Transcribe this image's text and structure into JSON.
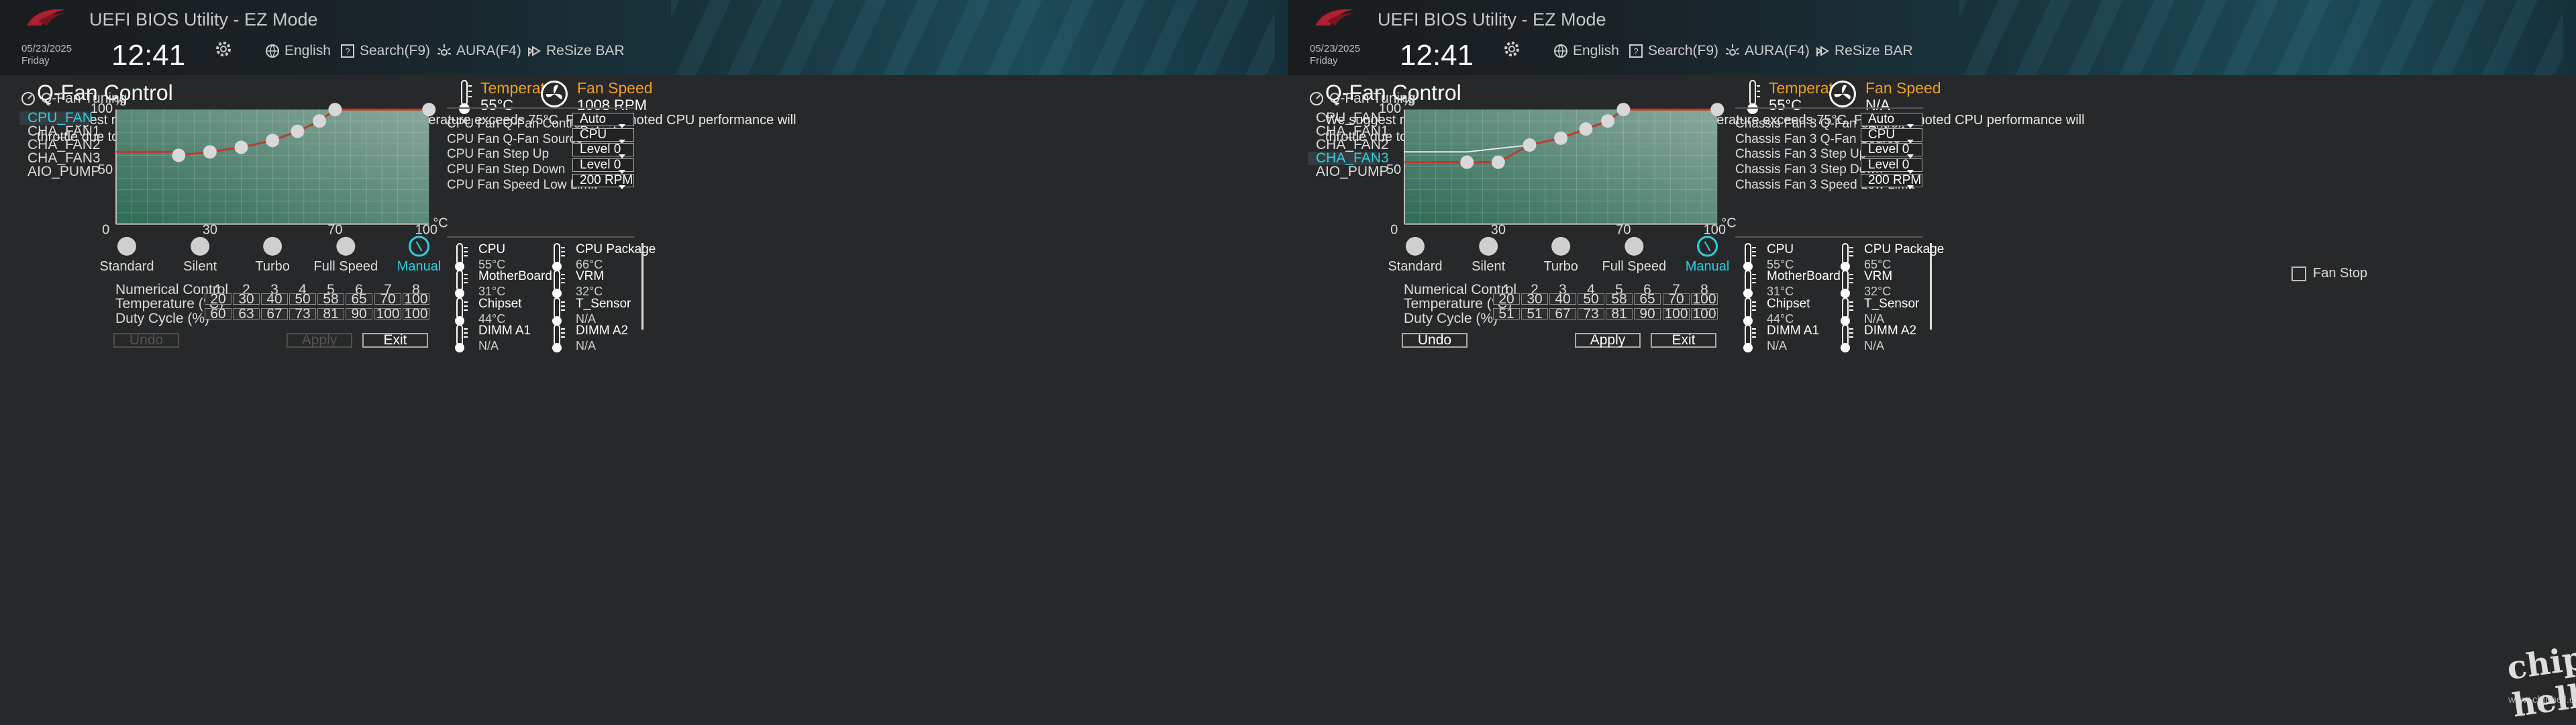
{
  "screens": [
    {
      "header": {
        "app_title": "UEFI BIOS Utility - EZ Mode",
        "date": "05/23/2025",
        "day": "Friday",
        "time": "12:41",
        "language": "English",
        "search": "Search(F9)",
        "aura": "AURA(F4)",
        "resize_bar": "ReSize BAR"
      },
      "page_title": "Q-Fan Control",
      "warning_line1": "We suggest raising your fan/pump duty to 100% if your CPU temperature exceeds 75°C. Please be noted CPU performance will",
      "warning_line2": "throttle due to overheating with inefficient fan/pump duty.",
      "tuning_label": "Q-Fan Tuning",
      "fans": [
        "CPU_FAN",
        "CHA_FAN1",
        "CHA_FAN2",
        "CHA_FAN3",
        "AIO_PUMP"
      ],
      "selected_fan": 0,
      "chart_data": {
        "type": "line",
        "xlabel": "°C",
        "ylabel": "%",
        "xlim": [
          0,
          100
        ],
        "ylim": [
          0,
          100
        ],
        "x_ticks": [
          "0",
          "30",
          "70",
          "100"
        ],
        "y_ticks": [
          "100",
          "50",
          "0"
        ],
        "grid": true,
        "series": [
          {
            "x": [
              0,
              20,
              20,
              30,
              40,
              50,
              58,
              65,
              70,
              100,
              100
            ],
            "y": [
              63,
              63,
              60,
              63,
              67,
              73,
              81,
              90,
              100,
              100,
              100
            ],
            "points": [
              [
                20,
                60
              ],
              [
                30,
                63
              ],
              [
                40,
                67
              ],
              [
                50,
                73
              ],
              [
                58,
                81
              ],
              [
                65,
                90
              ],
              [
                70,
                100
              ],
              [
                100,
                100
              ]
            ]
          }
        ],
        "reference_line": null
      },
      "presets": [
        "Standard",
        "Silent",
        "Turbo",
        "Full Speed",
        "Manual"
      ],
      "active_preset": 4,
      "fan_stop": null,
      "numerical_label": "Numerical Control",
      "temperature_label": "Temperature (°C)",
      "duty_label": "Duty Cycle (%)",
      "indices": [
        "1",
        "2",
        "3",
        "4",
        "5",
        "6",
        "7",
        "8"
      ],
      "temperatures": [
        "20",
        "30",
        "40",
        "50",
        "58",
        "65",
        "70",
        "100"
      ],
      "duties": [
        "60",
        "63",
        "67",
        "73",
        "81",
        "90",
        "100",
        "100"
      ],
      "buttons": {
        "undo": "Undo",
        "apply": "Apply",
        "exit": "Exit",
        "undo_disabled": true,
        "apply_disabled": true
      },
      "temp_title": "Temperature",
      "temp_value": "55°C",
      "fanspeed_title": "Fan Speed",
      "fanspeed_value": "1008 RPM",
      "controls": [
        {
          "label": "CPU Fan Q-Fan Control",
          "value": "Auto Detect"
        },
        {
          "label": "CPU Fan Q-Fan Source",
          "value": "CPU"
        },
        {
          "label": "CPU Fan Step Up",
          "value": "Level 0"
        },
        {
          "label": "CPU Fan Step Down",
          "value": "Level 0"
        },
        {
          "label": "CPU Fan Speed Low Limit",
          "value": "200 RPM"
        }
      ],
      "sensors": [
        {
          "name": "CPU",
          "value": "55°C"
        },
        {
          "name": "CPU Package",
          "value": "66°C"
        },
        {
          "name": "MotherBoard",
          "value": "31°C"
        },
        {
          "name": "VRM",
          "value": "32°C"
        },
        {
          "name": "Chipset",
          "value": "44°C"
        },
        {
          "name": "T_Sensor",
          "value": "N/A"
        },
        {
          "name": "DIMM A1",
          "value": "N/A"
        },
        {
          "name": "DIMM A2",
          "value": "N/A"
        }
      ]
    },
    {
      "header": {
        "app_title": "UEFI BIOS Utility - EZ Mode",
        "date": "05/23/2025",
        "day": "Friday",
        "time": "12:41",
        "language": "English",
        "search": "Search(F9)",
        "aura": "AURA(F4)",
        "resize_bar": "ReSize BAR"
      },
      "page_title": "Q-Fan Control",
      "warning_line1": "We suggest raising your fan/pump duty to 100% if your CPU temperature exceeds 75°C. Please be noted CPU performance will",
      "warning_line2": "throttle due to overheating with inefficient fan/pump duty.",
      "tuning_label": "Q-Fan Tuning",
      "fans": [
        "CPU_FAN",
        "CHA_FAN1",
        "CHA_FAN2",
        "CHA_FAN3",
        "AIO_PUMP"
      ],
      "selected_fan": 3,
      "chart_data": {
        "type": "line",
        "xlabel": "°C",
        "ylabel": "%",
        "xlim": [
          0,
          100
        ],
        "ylim": [
          0,
          100
        ],
        "x_ticks": [
          "0",
          "30",
          "70",
          "100"
        ],
        "y_ticks": [
          "100",
          "50",
          "0"
        ],
        "grid": true,
        "series": [
          {
            "x": [
              0,
              20,
              30,
              40,
              50,
              58,
              65,
              70,
              100
            ],
            "y": [
              54,
              54,
              54,
              69,
              75,
              83,
              90,
              100,
              100
            ],
            "points": [
              [
                20,
                54
              ],
              [
                30,
                54
              ],
              [
                40,
                69
              ],
              [
                50,
                75
              ],
              [
                58,
                83
              ],
              [
                65,
                90
              ],
              [
                70,
                100
              ],
              [
                100,
                100
              ]
            ]
          }
        ],
        "reference_line": {
          "x": [
            0,
            20,
            40
          ],
          "y": [
            63,
            63,
            69
          ]
        }
      },
      "presets": [
        "Standard",
        "Silent",
        "Turbo",
        "Full Speed",
        "Manual"
      ],
      "active_preset": 4,
      "fan_stop": "Fan Stop",
      "numerical_label": "Numerical Control",
      "temperature_label": "Temperature (°C)",
      "duty_label": "Duty Cycle (%)",
      "indices": [
        "1",
        "2",
        "3",
        "4",
        "5",
        "6",
        "7",
        "8"
      ],
      "temperatures": [
        "20",
        "30",
        "40",
        "50",
        "58",
        "65",
        "70",
        "100"
      ],
      "duties": [
        "51",
        "51",
        "67",
        "73",
        "81",
        "90",
        "100",
        "100"
      ],
      "buttons": {
        "undo": "Undo",
        "apply": "Apply",
        "exit": "Exit",
        "undo_disabled": false,
        "apply_disabled": false
      },
      "temp_title": "Temperature",
      "temp_value": "55°C",
      "fanspeed_title": "Fan Speed",
      "fanspeed_value": "N/A",
      "controls": [
        {
          "label": "Chassis Fan 3 Q-Fan Control",
          "value": "Auto Detect"
        },
        {
          "label": "Chassis Fan 3 Q-Fan Source",
          "value": "CPU"
        },
        {
          "label": "Chassis Fan 3 Step Up",
          "value": "Level 0"
        },
        {
          "label": "Chassis Fan 3 Step Down",
          "value": "Level 0"
        },
        {
          "label": "Chassis Fan 3 Speed Low Limit",
          "value": "200 RPM"
        }
      ],
      "sensors": [
        {
          "name": "CPU",
          "value": "55°C"
        },
        {
          "name": "CPU Package",
          "value": "65°C"
        },
        {
          "name": "MotherBoard",
          "value": "31°C"
        },
        {
          "name": "VRM",
          "value": "32°C"
        },
        {
          "name": "Chipset",
          "value": "44°C"
        },
        {
          "name": "T_Sensor",
          "value": "N/A"
        },
        {
          "name": "DIMM A1",
          "value": "N/A"
        },
        {
          "name": "DIMM A2",
          "value": "N/A"
        }
      ]
    }
  ],
  "watermark": "www.chiphell.com",
  "watermark_logo": "chip hell",
  "colors": {
    "accent_cyan": "#2fd0e0",
    "accent_orange": "#f0a020",
    "curve_red": "#c0392b",
    "chart_green": "#3a6b5a"
  },
  "icons": [
    "rog-logo-icon",
    "gear-icon",
    "globe-icon",
    "search-icon",
    "aura-icon",
    "resize-bar-icon",
    "gauge-icon",
    "thermometer-icon",
    "fan-icon"
  ]
}
